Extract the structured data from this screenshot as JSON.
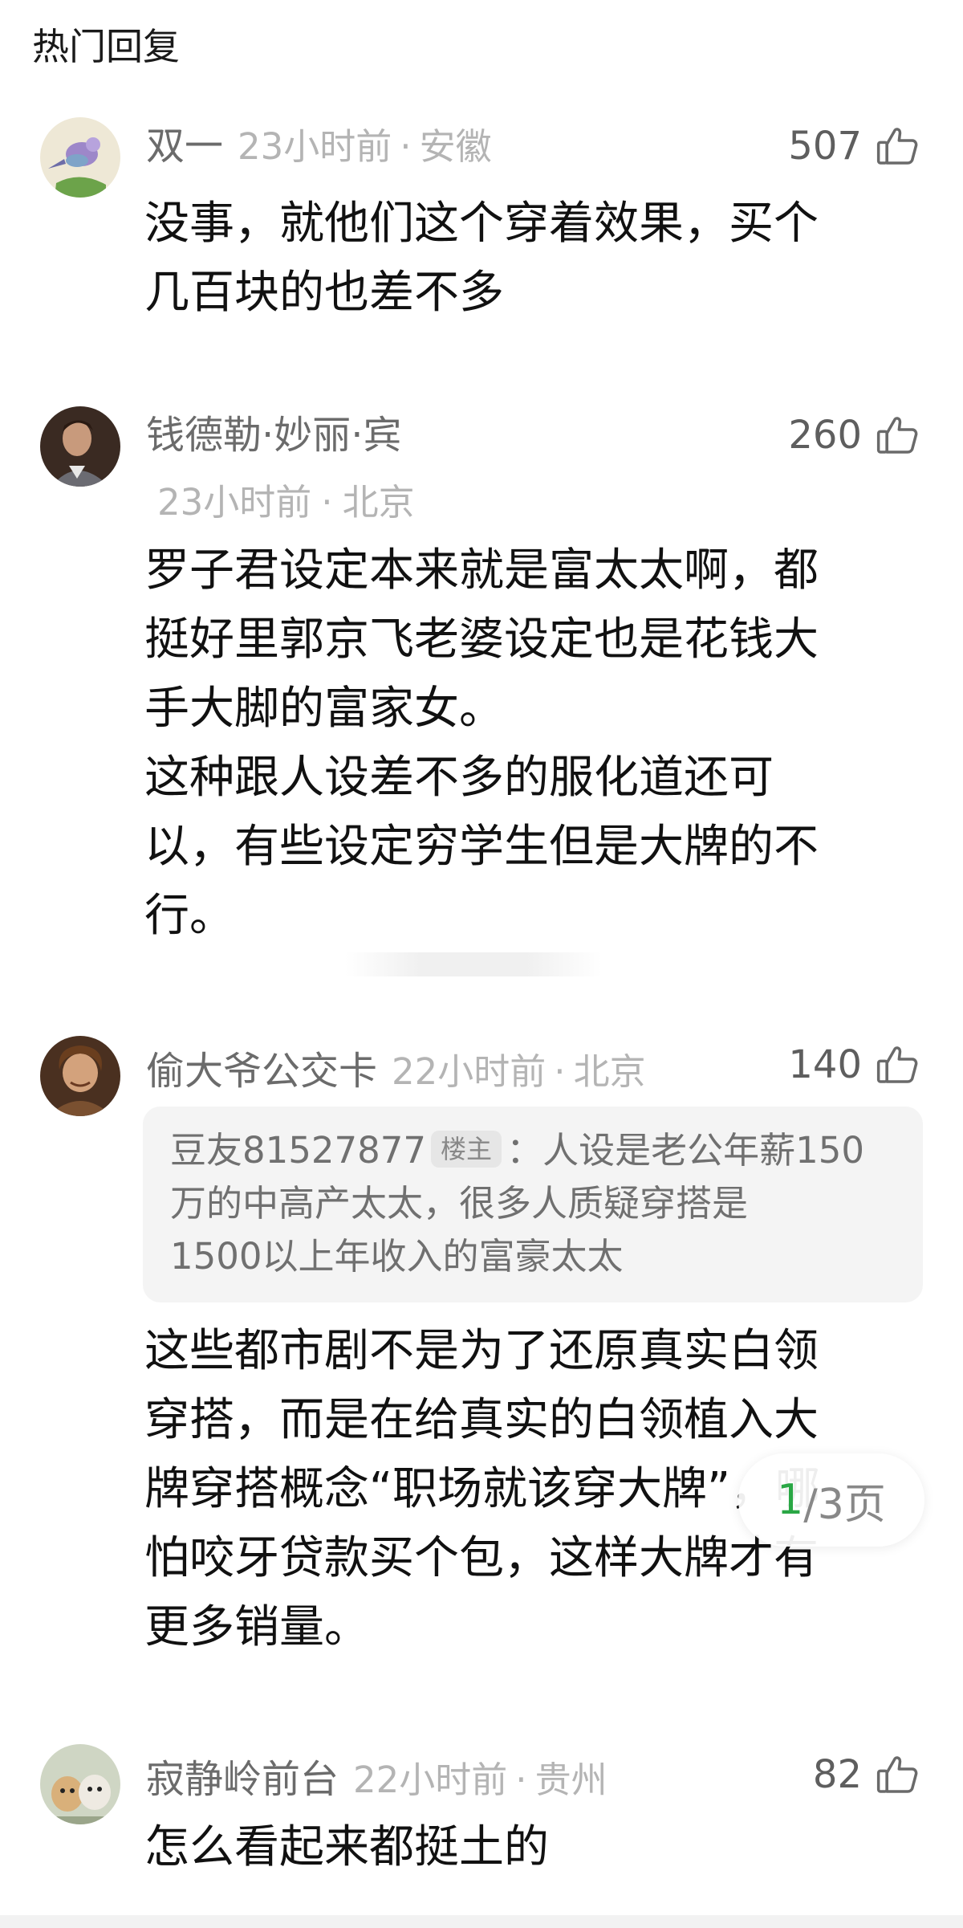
{
  "section": {
    "title": "热门回复"
  },
  "comments": [
    {
      "name": "双一",
      "time": "23小时前",
      "sep": "·",
      "location": "安徽",
      "likes": "507",
      "body": "没事，就他们这个穿着效果，买个\n几百块的也差不多"
    },
    {
      "name": "钱德勒·妙丽·宾",
      "time": "23小时前",
      "sep": "·",
      "location": "北京",
      "likes": "260",
      "body": "罗子君设定本来就是富太太啊，都\n挺好里郭京飞老婆设定也是花钱大\n手大脚的富家女。\n这种跟人设差不多的服化道还可\n以，有些设定穷学生但是大牌的不\n行。"
    },
    {
      "name": "偷大爷公交卡",
      "time": "22小时前",
      "sep": "·",
      "location": "北京",
      "likes": "140",
      "quote": {
        "user": "豆友81527877",
        "tag": "楼主",
        "text": "：人设是老公年薪150\n万的中高产太太，很多人质疑穿搭是\n1500以上年收入的富豪太太"
      },
      "body": "这些都市剧不是为了还原真实白领\n穿搭，而是在给真实的白领植入大\n牌穿搭概念“职场就该穿大牌”，哪\n怕咬牙贷款买个包，这样大牌才有\n更多销量。"
    },
    {
      "name": "寂静岭前台",
      "time": "22小时前",
      "sep": "·",
      "location": "贵州",
      "likes": "82",
      "body": "怎么看起来都挺土的"
    }
  ],
  "pager": {
    "current": "1",
    "total_text": "/3页"
  },
  "icons": {
    "like": "thumbs-up-icon"
  },
  "colors": {
    "accent": "#2aa745",
    "meta": "#b4b4b4",
    "name": "#6b6b6b"
  }
}
